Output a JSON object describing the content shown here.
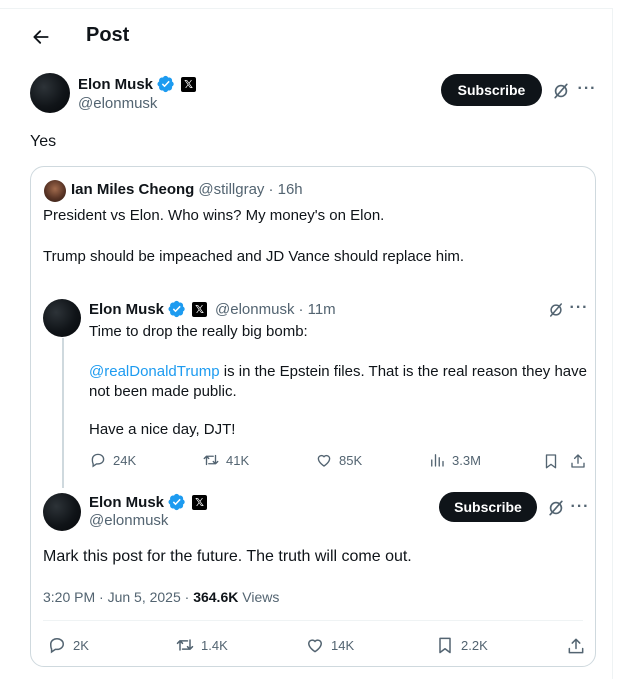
{
  "header": {
    "title": "Post"
  },
  "main_post": {
    "author_name": "Elon Musk",
    "author_handle": "@elonmusk",
    "subscribe_label": "Subscribe",
    "text": "Yes"
  },
  "quoted_post": {
    "author_name": "Ian Miles Cheong",
    "author_handle": "@stillgray",
    "time": "· 16h",
    "line1": "President vs Elon. Who wins? My money's on Elon.",
    "line2": "Trump should be impeached and JD Vance should replace him."
  },
  "thread_post_1": {
    "author_name": "Elon Musk",
    "author_handle": "@elonmusk",
    "time": "· 11m",
    "line1": "Time to drop the really big bomb:",
    "mention": "@realDonaldTrump",
    "line2_rest": " is in the Epstein files. That is the real reason they have not been made public.",
    "line3": "Have a nice day, DJT!",
    "stats": {
      "replies": "24K",
      "reposts": "41K",
      "likes": "85K",
      "views": "3.3M"
    }
  },
  "thread_post_2": {
    "author_name": "Elon Musk",
    "author_handle": "@elonmusk",
    "subscribe_label": "Subscribe",
    "text": "Mark this post for the future. The truth will come out.",
    "timestamp": "3:20 PM · Jun 5, 2025 · ",
    "views_count": "364.6K",
    "views_label": " Views",
    "stats": {
      "replies": "2K",
      "reposts": "1.4K",
      "likes": "14K",
      "bookmarks": "2.2K"
    }
  },
  "colors": {
    "accent": "#1d9bf0",
    "text": "#0f1419",
    "muted": "#536471",
    "border": "#cfd9de"
  },
  "icons": [
    "back-arrow-icon",
    "verified-badge-icon",
    "x-logo-icon",
    "grok-icon",
    "more-icon",
    "reply-icon",
    "repost-icon",
    "like-icon",
    "views-icon",
    "bookmark-icon",
    "share-icon"
  ]
}
